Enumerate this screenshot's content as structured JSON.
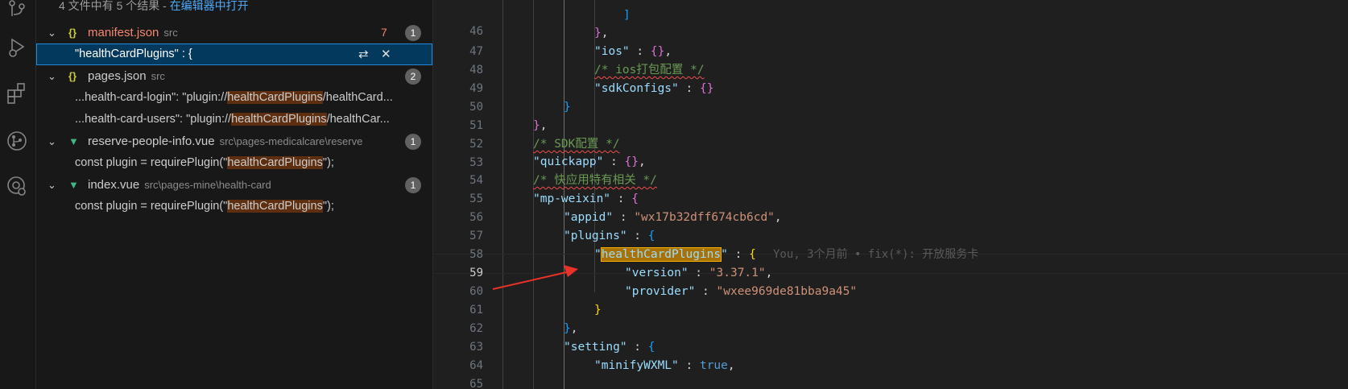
{
  "search": {
    "summary_text": "4 文件中有 5 个结果 - ",
    "open_in_editor": "在编辑器中打开"
  },
  "results": [
    {
      "file": "manifest.json",
      "path": "src",
      "icon": "json-icon",
      "error_count": "7",
      "count": "1",
      "matches": [
        {
          "prefix": "\"",
          "hit": "healthCardPlugins",
          "suffix": "\" : {"
        }
      ]
    },
    {
      "file": "pages.json",
      "path": "src",
      "icon": "json-icon",
      "count": "2",
      "matches": [
        {
          "prefix": "...health-card-login\": \"plugin://",
          "hit": "healthCardPlugins",
          "suffix": "/healthCard..."
        },
        {
          "prefix": "...health-card-users\": \"plugin://",
          "hit": "healthCardPlugins",
          "suffix": "/healthCar..."
        }
      ]
    },
    {
      "file": "reserve-people-info.vue",
      "path": "src\\pages-medicalcare\\reserve",
      "icon": "vue-icon",
      "count": "1",
      "matches": [
        {
          "prefix": "const plugin = requirePlugin(\"",
          "hit": "healthCardPlugins",
          "suffix": "\");"
        }
      ]
    },
    {
      "file": "index.vue",
      "path": "src\\pages-mine\\health-card",
      "icon": "vue-icon",
      "count": "1",
      "matches": [
        {
          "prefix": "const plugin = requirePlugin(\"",
          "hit": "healthCardPlugins",
          "suffix": "\");"
        }
      ]
    }
  ],
  "editor": {
    "line_numbers": [
      "46",
      "47",
      "48",
      "49",
      "50",
      "51",
      "52",
      "53",
      "54",
      "55",
      "56",
      "57",
      "58",
      "59",
      "60",
      "61",
      "62",
      "63",
      "64",
      "65"
    ],
    "active_line": "59",
    "blame": "You, 3个月前 • fix(*): 开放服务卡",
    "comments": {
      "ios": "/* ios打包配置 */",
      "sdk": "/* SDK配置 */",
      "quickapp": "/* 快应用特有相关 */"
    },
    "keys": {
      "ios": "\"ios\"",
      "sdkConfigs": "\"sdkConfigs\"",
      "quickapp": "\"quickapp\"",
      "mpweixin": "\"mp-weixin\"",
      "appid": "\"appid\"",
      "plugins": "\"plugins\"",
      "healthCardPlugins": "healthCardPlugins",
      "version": "\"version\"",
      "provider": "\"provider\"",
      "setting": "\"setting\"",
      "minifyWXML": "\"minifyWXML\""
    },
    "values": {
      "appid": "\"wx17b32dff674cb6cd\"",
      "version": "\"3.37.1\"",
      "provider": "\"wxee969de81bba9a45\"",
      "minifyWXML": "true"
    }
  },
  "colors": {
    "accent": "#2488db",
    "match_highlight": "#ea5c00",
    "annotation_arrow": "#e8322a"
  }
}
